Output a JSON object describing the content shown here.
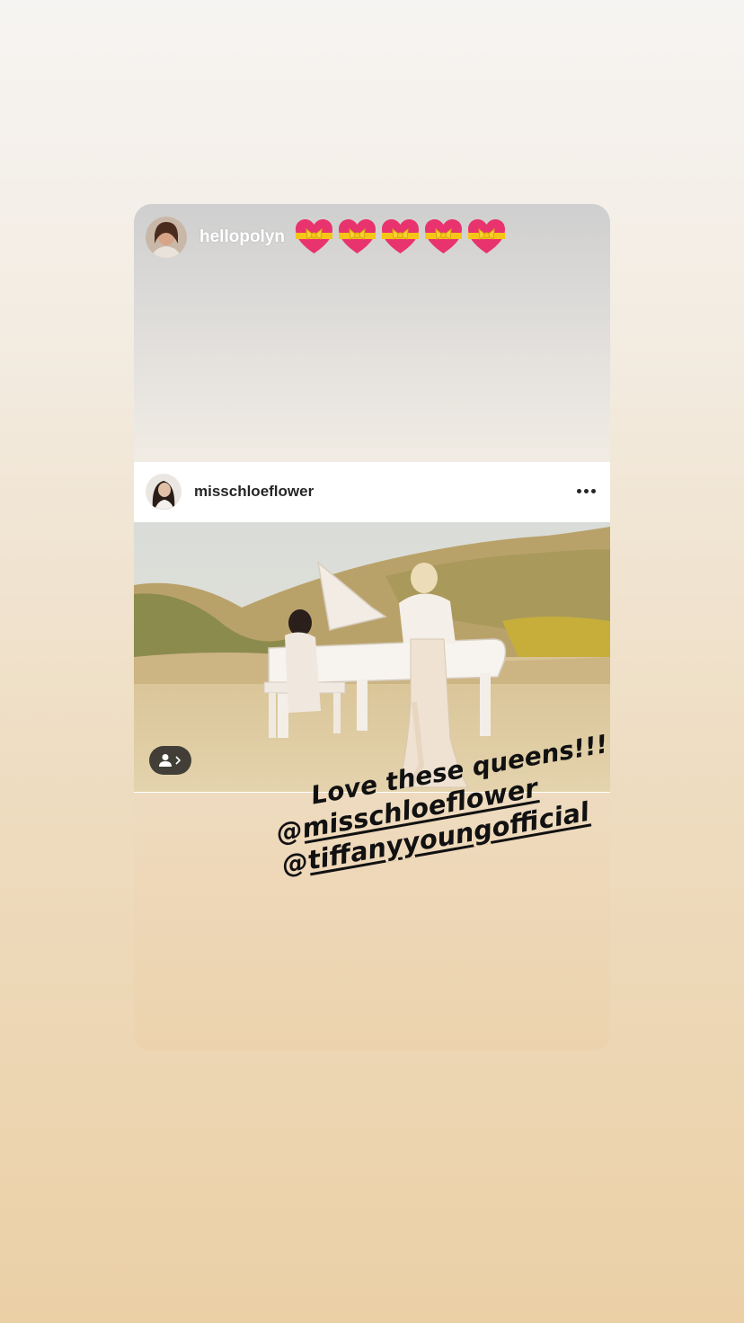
{
  "story": {
    "username": "hellopolyn",
    "reaction_icons": [
      "gift-heart-icon",
      "gift-heart-icon",
      "gift-heart-icon",
      "gift-heart-icon",
      "gift-heart-icon"
    ]
  },
  "embedded_post": {
    "username": "misschloeflower",
    "more_icon": "more-horizontal-icon",
    "tag_icon": "user-tag-icon"
  },
  "caption": {
    "line1": "Love these queens!!!",
    "mention1_at": "@",
    "mention1": "misschloeflower",
    "mention2_at": "@",
    "mention2": "tiffanyyoungofficial"
  },
  "colors": {
    "heart_pink": "#e8336f",
    "ribbon_yellow": "#f5c518",
    "text_dark": "#262626"
  }
}
